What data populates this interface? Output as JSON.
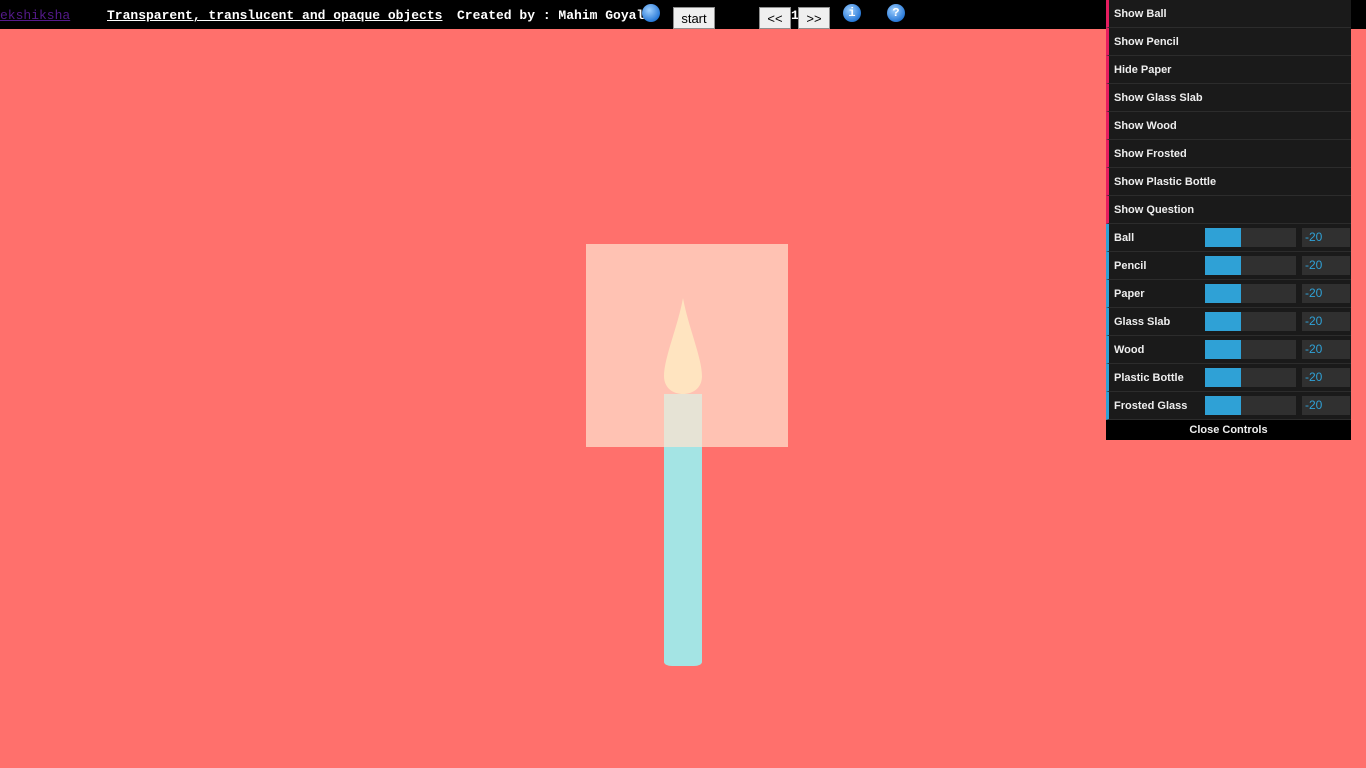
{
  "topbar": {
    "brand": "ekshiksha",
    "title": "Transparent, translucent and opaque objects",
    "credit": "Created by : Mahim Goyal",
    "start_label": "start",
    "prev_label": "<<",
    "page_number": "1",
    "next_label": ">>",
    "info_glyph": "i",
    "help_glyph": "?"
  },
  "controls": {
    "buttons": [
      "Show Ball",
      "Show Pencil",
      "Hide Paper",
      "Show Glass Slab",
      "Show Wood",
      "Show Frosted",
      "Show Plastic Bottle",
      "Show Question"
    ],
    "sliders": [
      {
        "label": "Ball",
        "value": "-20",
        "fill": 0.4
      },
      {
        "label": "Pencil",
        "value": "-20",
        "fill": 0.4
      },
      {
        "label": "Paper",
        "value": "-20",
        "fill": 0.4
      },
      {
        "label": "Glass Slab",
        "value": "-20",
        "fill": 0.4
      },
      {
        "label": "Wood",
        "value": "-20",
        "fill": 0.4
      },
      {
        "label": "Plastic Bottle",
        "value": "-20",
        "fill": 0.4
      },
      {
        "label": "Frosted Glass",
        "value": "-20",
        "fill": 0.4
      }
    ],
    "close_label": "Close Controls"
  },
  "colors": {
    "background": "#ff706c",
    "candle": "#a4e4e4",
    "flame": "#ffe89a",
    "paper": "#ffe2ce",
    "slider_accent": "#2fa1d6",
    "button_accent": "#e61d5f"
  }
}
